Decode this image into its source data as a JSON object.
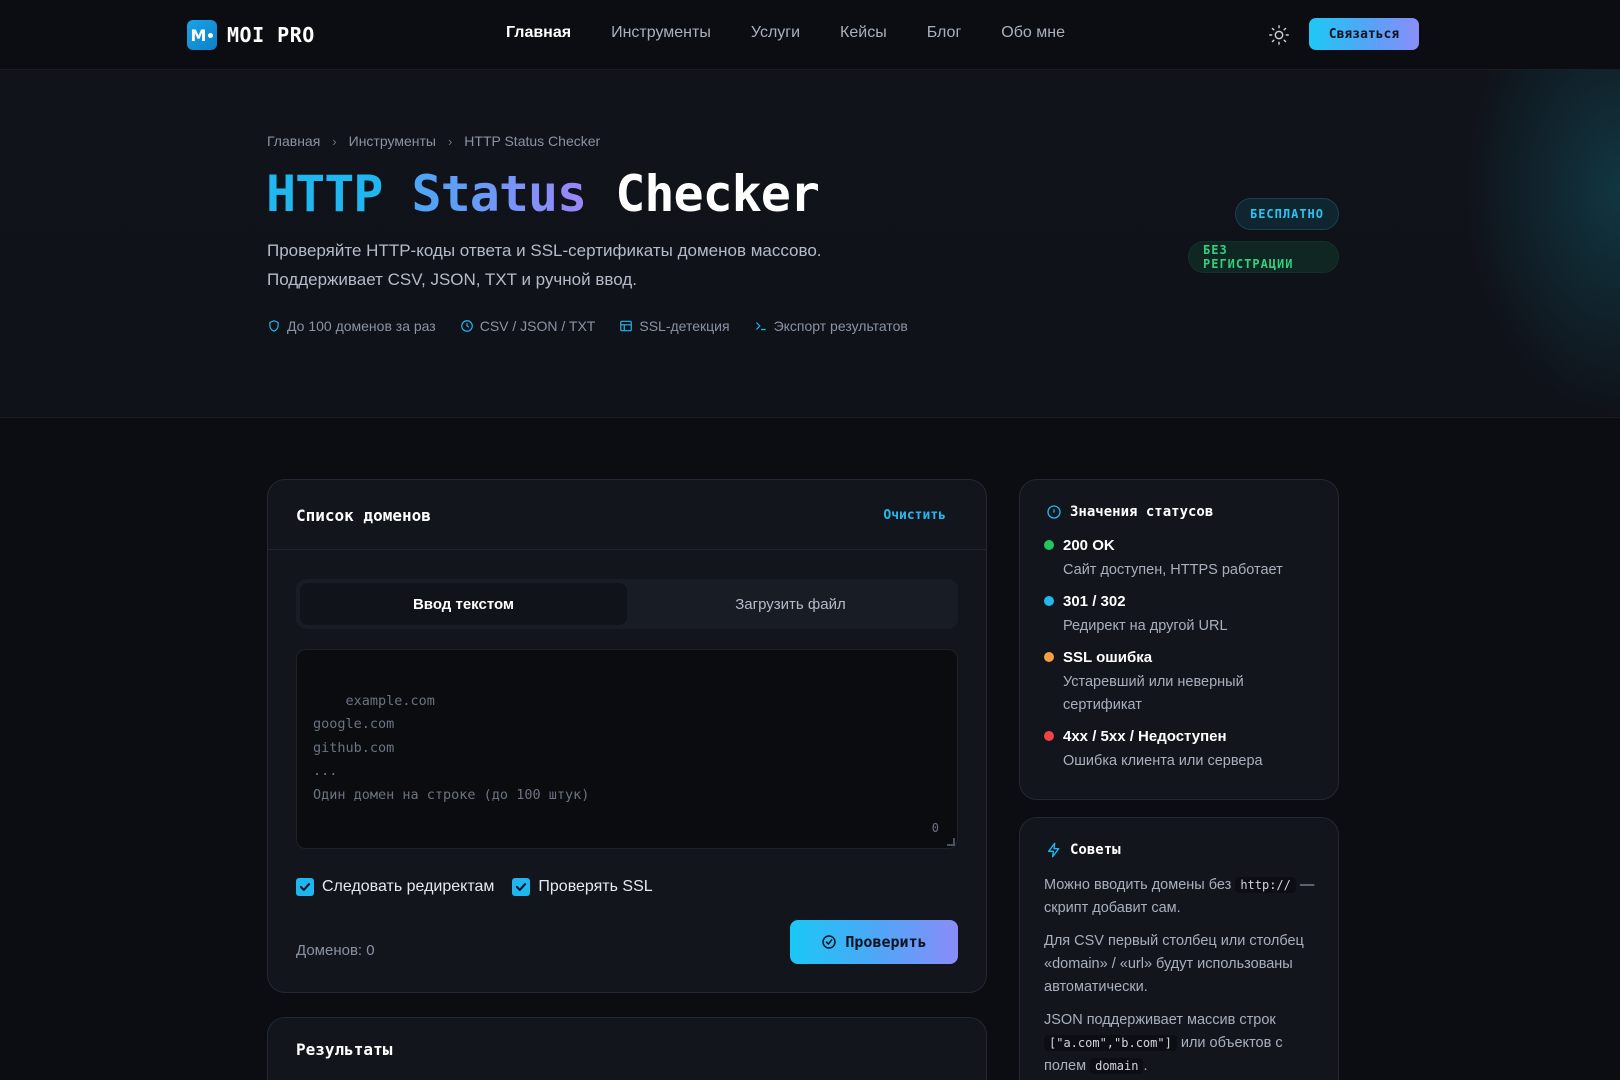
{
  "nav": {
    "logo_text": "MOI PRO",
    "logo_mark": "M",
    "items": [
      {
        "label": "Главная",
        "active": true
      },
      {
        "label": "Инструменты",
        "active": false
      },
      {
        "label": "Услуги",
        "active": false
      },
      {
        "label": "Кейсы",
        "active": false
      },
      {
        "label": "Блог",
        "active": false
      },
      {
        "label": "Обо мне",
        "active": false
      }
    ],
    "theme_icon": "sun-icon",
    "cta_label": "Связаться"
  },
  "breadcrumb": [
    "Главная",
    "Инструменты",
    "HTTP Status Checker"
  ],
  "hero": {
    "title_part1": "HTTP",
    "title_part2": "Status",
    "title_part3": "Checker",
    "subtitle": "Проверяйте HTTP-коды ответа и SSL-сертификаты доменов массово. Поддерживает CSV, JSON, TXT и ручной ввод.",
    "features": [
      {
        "icon": "shield-icon",
        "label": "До 100 доменов за раз"
      },
      {
        "icon": "clock-icon",
        "label": "CSV / JSON / TXT"
      },
      {
        "icon": "layout-icon",
        "label": "SSL-детекция"
      },
      {
        "icon": "terminal-icon",
        "label": "Экспорт результатов"
      }
    ],
    "badges": [
      "БЕСПЛАТНО",
      "БЕЗ РЕГИСТРАЦИИ"
    ]
  },
  "domains_card": {
    "title": "Список доменов",
    "clear_label": "Очистить",
    "tabs": [
      {
        "label": "Ввод текстом",
        "active": true
      },
      {
        "label": "Загрузить файл",
        "active": false
      }
    ],
    "textarea_placeholder": "example.com\ngoogle.com\ngithub.com\n...\nОдин домен на строке (до 100 штук)",
    "char_count": "0",
    "options": [
      {
        "label": "Следовать редиректам",
        "checked": true
      },
      {
        "label": "Проверять SSL",
        "checked": true
      }
    ],
    "domain_count_label": "Доменов: 0",
    "submit_label": "Проверить"
  },
  "results_card": {
    "title": "Результаты"
  },
  "status_card": {
    "title": "Значения статусов",
    "items": [
      {
        "name": "200 OK",
        "desc": "Сайт доступен, HTTPS работает",
        "color": "#22c55e"
      },
      {
        "name": "301 / 302",
        "desc": "Редирект на другой URL",
        "color": "#22b8ee"
      },
      {
        "name": "SSL ошибка",
        "desc": "Устаревший или неверный сертификат",
        "color": "#f59e42"
      },
      {
        "name": "4xx / 5xx / Недоступен",
        "desc": "Ошибка клиента или сервера",
        "color": "#ef4444"
      }
    ]
  },
  "tips_card": {
    "title": "Советы",
    "tip1_a": "Можно вводить домены без",
    "tip1_code": "http://",
    "tip1_b": "— скрипт добавит сам.",
    "tip2": "Для CSV первый столбец или столбец «domain» / «url» будут использованы автоматически.",
    "tip3_a": "JSON поддерживает массив строк",
    "tip3_code1": "[\"a.com\",\"b.com\"]",
    "tip3_b": "или объектов с полем",
    "tip3_code2": "domain",
    "tip3_c": "."
  },
  "colors": {
    "accent": "#1fb6ef",
    "accent_purple": "#8a8ef8",
    "success": "#33d07f",
    "background": "#0b0d12",
    "card": "#12151c"
  }
}
